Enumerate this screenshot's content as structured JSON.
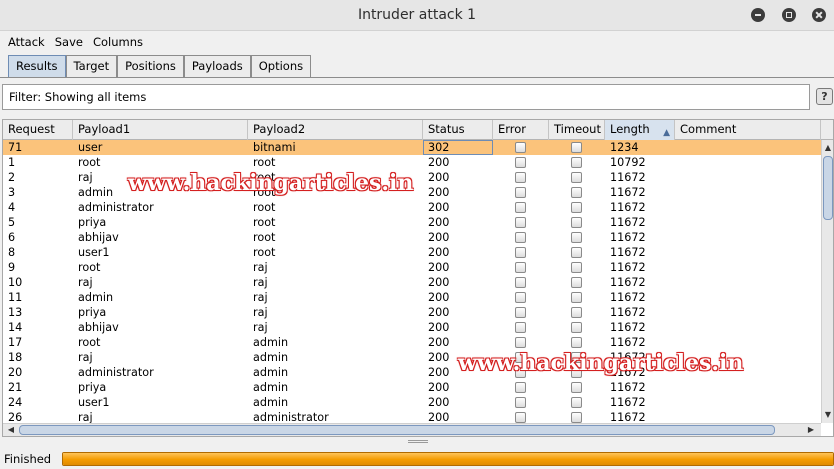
{
  "window": {
    "title": "Intruder attack 1"
  },
  "menu": [
    "Attack",
    "Save",
    "Columns"
  ],
  "tabs": [
    {
      "label": "Results",
      "active": true
    },
    {
      "label": "Target",
      "active": false
    },
    {
      "label": "Positions",
      "active": false
    },
    {
      "label": "Payloads",
      "active": false
    },
    {
      "label": "Options",
      "active": false
    }
  ],
  "filter": {
    "text": "Filter: Showing all items",
    "help_label": "?"
  },
  "table": {
    "columns": [
      {
        "key": "request",
        "label": "Request"
      },
      {
        "key": "payload1",
        "label": "Payload1"
      },
      {
        "key": "payload2",
        "label": "Payload2"
      },
      {
        "key": "status",
        "label": "Status"
      },
      {
        "key": "error",
        "label": "Error"
      },
      {
        "key": "timeout",
        "label": "Timeout"
      },
      {
        "key": "length",
        "label": "Length",
        "sorted": "ascending"
      },
      {
        "key": "comment",
        "label": "Comment"
      }
    ],
    "rows": [
      {
        "request": "71",
        "payload1": "user",
        "payload2": "bitnami",
        "status": "302",
        "error": false,
        "timeout": false,
        "length": "1234",
        "comment": "",
        "selected": true
      },
      {
        "request": "1",
        "payload1": "root",
        "payload2": "root",
        "status": "200",
        "error": false,
        "timeout": false,
        "length": "10792",
        "comment": ""
      },
      {
        "request": "2",
        "payload1": "raj",
        "payload2": "root",
        "status": "200",
        "error": false,
        "timeout": false,
        "length": "11672",
        "comment": ""
      },
      {
        "request": "3",
        "payload1": "admin",
        "payload2": "root",
        "status": "200",
        "error": false,
        "timeout": false,
        "length": "11672",
        "comment": ""
      },
      {
        "request": "4",
        "payload1": "administrator",
        "payload2": "root",
        "status": "200",
        "error": false,
        "timeout": false,
        "length": "11672",
        "comment": ""
      },
      {
        "request": "5",
        "payload1": "priya",
        "payload2": "root",
        "status": "200",
        "error": false,
        "timeout": false,
        "length": "11672",
        "comment": ""
      },
      {
        "request": "6",
        "payload1": "abhijav",
        "payload2": "root",
        "status": "200",
        "error": false,
        "timeout": false,
        "length": "11672",
        "comment": ""
      },
      {
        "request": "8",
        "payload1": "user1",
        "payload2": "root",
        "status": "200",
        "error": false,
        "timeout": false,
        "length": "11672",
        "comment": ""
      },
      {
        "request": "9",
        "payload1": "root",
        "payload2": "raj",
        "status": "200",
        "error": false,
        "timeout": false,
        "length": "11672",
        "comment": ""
      },
      {
        "request": "10",
        "payload1": "raj",
        "payload2": "raj",
        "status": "200",
        "error": false,
        "timeout": false,
        "length": "11672",
        "comment": ""
      },
      {
        "request": "11",
        "payload1": "admin",
        "payload2": "raj",
        "status": "200",
        "error": false,
        "timeout": false,
        "length": "11672",
        "comment": ""
      },
      {
        "request": "13",
        "payload1": "priya",
        "payload2": "raj",
        "status": "200",
        "error": false,
        "timeout": false,
        "length": "11672",
        "comment": ""
      },
      {
        "request": "14",
        "payload1": "abhijav",
        "payload2": "raj",
        "status": "200",
        "error": false,
        "timeout": false,
        "length": "11672",
        "comment": ""
      },
      {
        "request": "17",
        "payload1": "root",
        "payload2": "admin",
        "status": "200",
        "error": false,
        "timeout": false,
        "length": "11672",
        "comment": ""
      },
      {
        "request": "18",
        "payload1": "raj",
        "payload2": "admin",
        "status": "200",
        "error": false,
        "timeout": false,
        "length": "11672",
        "comment": ""
      },
      {
        "request": "20",
        "payload1": "administrator",
        "payload2": "admin",
        "status": "200",
        "error": false,
        "timeout": false,
        "length": "11672",
        "comment": ""
      },
      {
        "request": "21",
        "payload1": "priya",
        "payload2": "admin",
        "status": "200",
        "error": false,
        "timeout": false,
        "length": "11672",
        "comment": ""
      },
      {
        "request": "24",
        "payload1": "user1",
        "payload2": "admin",
        "status": "200",
        "error": false,
        "timeout": false,
        "length": "11672",
        "comment": ""
      },
      {
        "request": "26",
        "payload1": "raj",
        "payload2": "administrator",
        "status": "200",
        "error": false,
        "timeout": false,
        "length": "11672",
        "comment": ""
      }
    ]
  },
  "status": {
    "text": "Finished",
    "progress": 1.0
  },
  "watermarks": [
    "www.hackingarticles.in",
    "www.hackingarticles.in"
  ]
}
